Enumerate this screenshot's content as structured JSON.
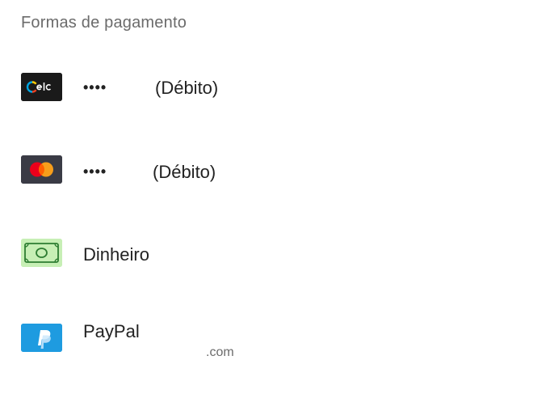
{
  "section": {
    "title": "Formas de pagamento"
  },
  "methods": [
    {
      "icon": "elo-card-icon",
      "masked_number": "••••",
      "card_type": "(Débito)"
    },
    {
      "icon": "mastercard-icon",
      "masked_number": "••••",
      "card_type": "(Débito)"
    },
    {
      "icon": "cash-icon",
      "label": "Dinheiro"
    },
    {
      "icon": "paypal-icon",
      "label": "PayPal",
      "sublabel": ".com"
    }
  ],
  "colors": {
    "elo_bg": "#1a1a1a",
    "mastercard_bg": "#3a3b45",
    "mastercard_red": "#eb001b",
    "mastercard_orange": "#f79e1b",
    "cash_bg": "#c7efb5",
    "cash_stroke": "#2e7d32",
    "paypal_bg": "#1e9be0"
  }
}
